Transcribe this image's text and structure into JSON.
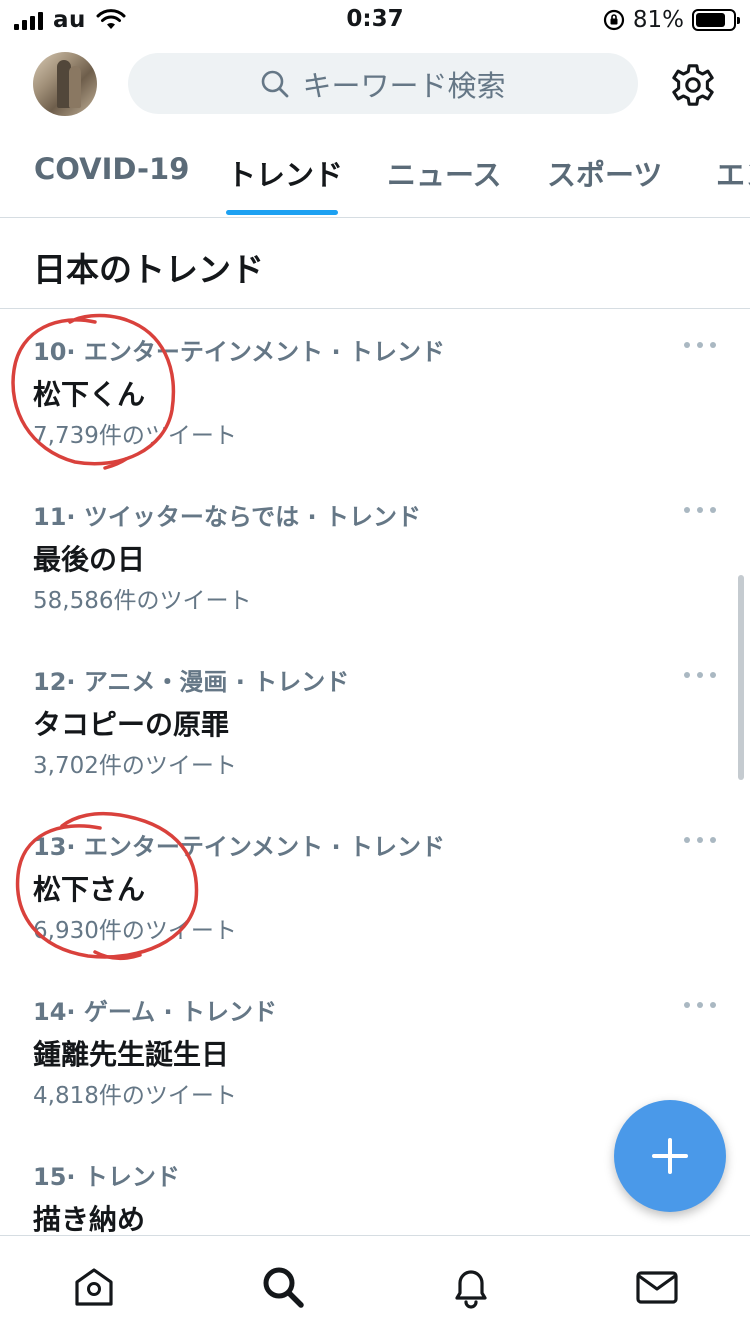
{
  "status_bar": {
    "carrier": "au",
    "time": "0:37",
    "battery_percent": "81%",
    "battery_level": 0.81
  },
  "header": {
    "search_placeholder": "キーワード検索",
    "avatar_icon": "avatar",
    "settings_icon": "gear-icon"
  },
  "tabs": [
    {
      "label": "COVID-19",
      "active": false
    },
    {
      "label": "トレンド",
      "active": true
    },
    {
      "label": "ニュース",
      "active": false
    },
    {
      "label": "スポーツ",
      "active": false
    },
    {
      "label": "エン",
      "active": false
    }
  ],
  "section_title": "日本のトレンド",
  "trends": [
    {
      "rank": "10",
      "category": "· エンターテインメント · トレンド",
      "title": "松下くん",
      "count": "7,739件のツイート",
      "annotated": true
    },
    {
      "rank": "11",
      "category": "· ツイッターならでは · トレンド",
      "title": "最後の日",
      "count": "58,586件のツイート",
      "annotated": false
    },
    {
      "rank": "12",
      "category": "· アニメ・漫画 · トレンド",
      "title": "タコピーの原罪",
      "count": "3,702件のツイート",
      "annotated": false
    },
    {
      "rank": "13",
      "category": "· エンターテインメント · トレンド",
      "title": "松下さん",
      "count": "6,930件のツイート",
      "annotated": true
    },
    {
      "rank": "14",
      "category": "· ゲーム · トレンド",
      "title": "鍾離先生誕生日",
      "count": "4,818件のツイート",
      "annotated": false
    },
    {
      "rank": "15",
      "category": "· トレンド",
      "title": "描き納め",
      "count": "",
      "annotated": false
    }
  ],
  "colors": {
    "accent": "#1da1f2",
    "fab": "#4a99e9",
    "annotation": "#d9413c",
    "secondary_text": "#657786"
  },
  "bottom_nav": [
    {
      "icon": "home-icon"
    },
    {
      "icon": "search-icon",
      "active": true
    },
    {
      "icon": "bell-icon"
    },
    {
      "icon": "mail-icon"
    }
  ]
}
